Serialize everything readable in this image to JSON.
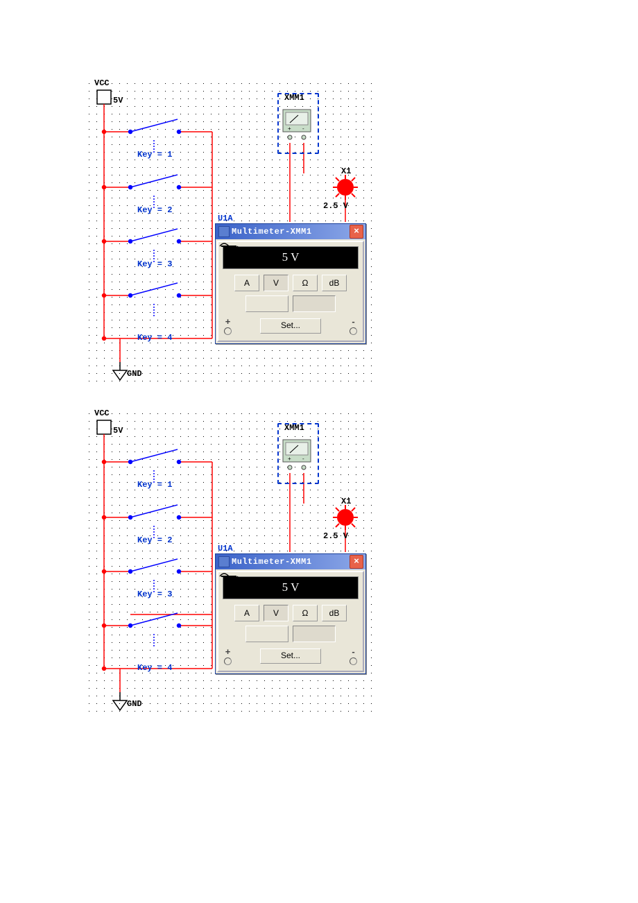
{
  "circuits": [
    {
      "vcc_label": "VCC",
      "vcc_value": "5V",
      "gnd_label": "GND",
      "keys": [
        "Key = 1",
        "Key = 2",
        "Key = 3",
        "Key = 4"
      ],
      "gate_label": "U1A",
      "xmm_label": "XMM1",
      "probe_label": "X1",
      "probe_value": "2.5 V",
      "multimeter": {
        "title": "Multimeter-XMM1",
        "reading": "5 V",
        "buttons": {
          "amp": "A",
          "volt": "V",
          "ohm": "Ω",
          "db": "dB"
        },
        "set": "Set...",
        "plus": "+",
        "minus": "-"
      }
    },
    {
      "vcc_label": "VCC",
      "vcc_value": "5V",
      "gnd_label": "GND",
      "keys": [
        "Key = 1",
        "Key = 2",
        "Key = 3",
        "Key = 4"
      ],
      "gate_label": "U1A",
      "xmm_label": "XMM1",
      "probe_label": "X1",
      "probe_value": "2.5 V",
      "multimeter": {
        "title": "Multimeter-XMM1",
        "reading": "5 V",
        "buttons": {
          "amp": "A",
          "volt": "V",
          "ohm": "Ω",
          "db": "dB"
        },
        "set": "Set...",
        "plus": "+",
        "minus": "-"
      }
    }
  ]
}
